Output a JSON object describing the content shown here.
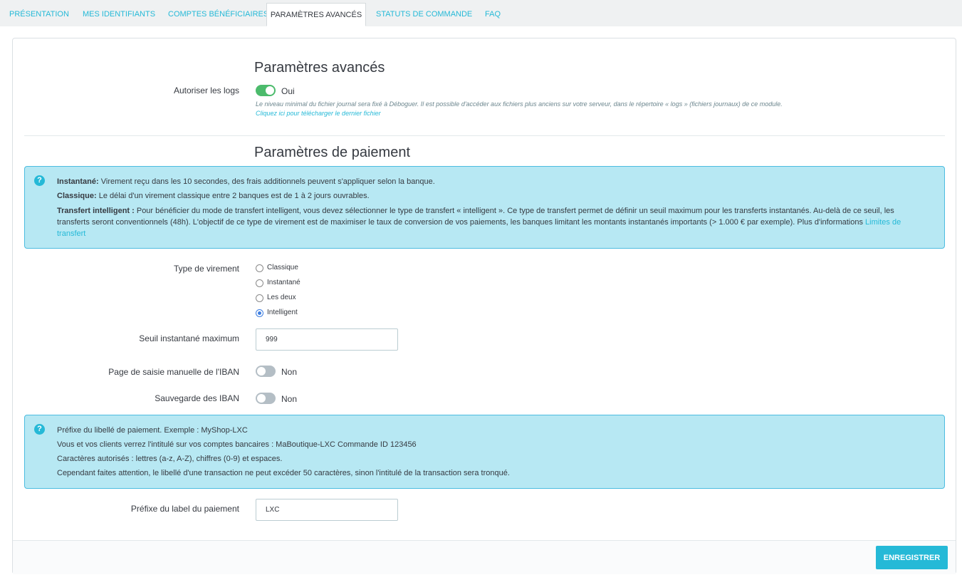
{
  "tabs": [
    {
      "label": "Présentation"
    },
    {
      "label": "Mes identifiants"
    },
    {
      "label": "Comptes bénéficiaires"
    },
    {
      "label": "Paramètres avancés",
      "active": true
    },
    {
      "label": "Statuts de commande"
    },
    {
      "label": "FAQ"
    }
  ],
  "advanced": {
    "title": "Paramètres avancés",
    "logs_label": "Autoriser les logs",
    "logs_value": "Oui",
    "logs_help": "Le niveau minimal du fichier journal sera fixé à Déboguer. Il est possible d'accéder aux fichiers plus anciens sur votre serveur, dans le répertoire « logs » (fichiers journaux) de ce module.",
    "logs_download": "Cliquez ici pour télécharger le dernier fichier"
  },
  "payment": {
    "title": "Paramètres de paiement",
    "info": {
      "instant_label": "Instantané:",
      "instant_text": " Virement reçu dans les 10 secondes, des frais additionnels peuvent s'appliquer selon la banque.",
      "classic_label": "Classique:",
      "classic_text": " Le délai d'un virement classique entre 2 banques est de 1 à 2 jours ouvrables.",
      "smart_label": "Transfert intelligent :",
      "smart_text": " Pour bénéficier du mode de transfert intelligent, vous devez sélectionner le type de transfert « intelligent ». Ce type de transfert permet de définir un seuil maximum pour les transferts instantanés. Au-delà de ce seuil, les transferts seront conventionnels (48h). L'objectif de ce type de virement est de maximiser le taux de conversion de vos paiements, les banques limitant les montants instantanés importants (> 1.000 € par exemple). Plus d'informations ",
      "smart_link": "Limites de transfert"
    },
    "transfer_type_label": "Type de virement",
    "transfer_options": [
      {
        "label": "Classique",
        "checked": false
      },
      {
        "label": "Instantané",
        "checked": false
      },
      {
        "label": "Les deux",
        "checked": false
      },
      {
        "label": "Intelligent",
        "checked": true
      }
    ],
    "threshold_label": "Seuil instantané maximum",
    "threshold_value": "999",
    "iban_page_label": "Page de saisie manuelle de l'IBAN",
    "iban_page_value": "Non",
    "iban_save_label": "Sauvegarde des IBAN",
    "iban_save_value": "Non",
    "prefix_info": [
      "Préfixe du libellé de paiement. Exemple : MyShop-LXC",
      "Vous et vos clients verrez l'intitulé sur vos comptes bancaires : MaBoutique-LXC Commande ID 123456",
      "Caractères autorisés : lettres (a-z, A-Z), chiffres (0-9) et espaces.",
      "Cependant faites attention, le libellé d'une transaction ne peut excéder 50 caractères, sinon l'intitulé de la transaction sera tronqué."
    ],
    "prefix_label": "Préfixe du label du paiement",
    "prefix_value": "LXC"
  },
  "footer": {
    "save_label": "Enregistrer"
  },
  "colors": {
    "accent": "#25b9d7",
    "switch_on": "#4cbb6c",
    "switch_off": "#b4bec5",
    "alert_bg": "#b7e8f3"
  },
  "icons": {
    "help": "question-circle-icon"
  }
}
